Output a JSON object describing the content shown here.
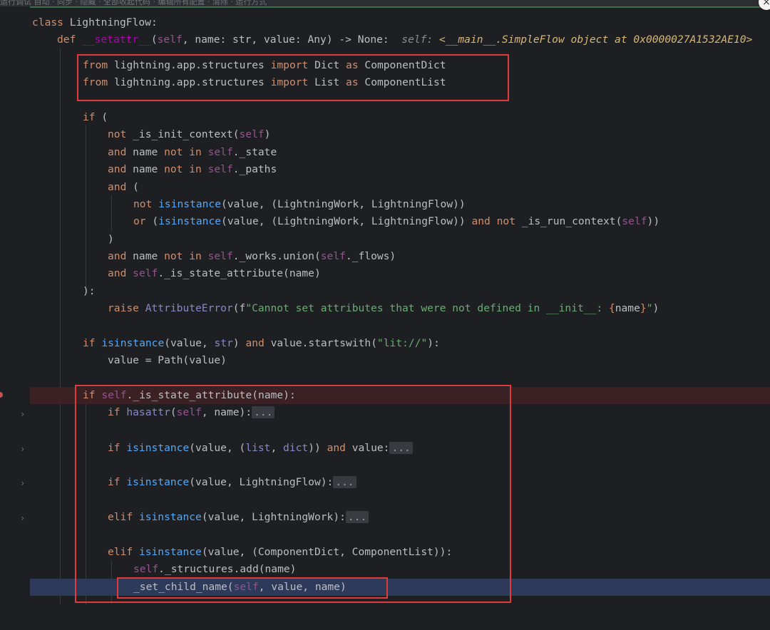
{
  "window": {
    "topbar_text": "运行调试    自动 · 同步 · 隐藏 · 全部收起代码 · 编辑所有配置 · 清除 · 运行方式",
    "close_icon_glyph": "×"
  },
  "colors": {
    "background": "#1e1f22",
    "keyword": "#cf8e6d",
    "self": "#94558d",
    "function": "#56a8f5",
    "string": "#6aab73",
    "breakpoint_line": "#3b2123",
    "current_line": "#2d3a5a",
    "annotation_box": "#e23a3a"
  },
  "code": {
    "class_line": {
      "kw": "class",
      "name": "LightningFlow:"
    },
    "def_line": {
      "kw": "def",
      "fn": "__setattr__",
      "open": "(",
      "self": "self",
      "params": ", name: str, value: Any) -> None:",
      "hint_label": "self:",
      "hint_value": "<__main__.SimpleFlow object at 0x0000027A1532AE10>"
    },
    "import1": {
      "from": "from",
      "mod": " lightning.app.structures ",
      "imp": "import",
      "name": " Dict ",
      "as": "as",
      "alias": " ComponentDict"
    },
    "import2": {
      "from": "from",
      "mod": " lightning.app.structures ",
      "imp": "import",
      "name": " List ",
      "as": "as",
      "alias": " ComponentList"
    },
    "if_open": {
      "kw": "if",
      "rest": " ("
    },
    "cond1": {
      "kw": "not",
      "fn": " _is_init_context(",
      "self": "self",
      "end": ")"
    },
    "cond2": {
      "kw": "and",
      "a": " name ",
      "kw2": "not in",
      "b": " ",
      "self": "self",
      "c": "._state"
    },
    "cond3": {
      "kw": "and",
      "a": " name ",
      "kw2": "not in",
      "b": " ",
      "self": "self",
      "c": "._paths"
    },
    "cond4": {
      "kw": "and",
      "rest": " ("
    },
    "cond5": {
      "kw": "not",
      "fn": " isinstance",
      "rest": "(value, (LightningWork, LightningFlow))"
    },
    "cond6": {
      "kw": "or",
      "a": " (",
      "fn": "isinstance",
      "b": "(value, (LightningWork, LightningFlow)) ",
      "kw2": "and not",
      "c": " _is_run_context(",
      "self": "self",
      "d": "))"
    },
    "cond_close": ")",
    "cond7": {
      "kw": "and",
      "a": " name ",
      "kw2": "not in",
      "b": " ",
      "self": "self",
      "c": "._works.union(",
      "self2": "self",
      "d": "._flows)"
    },
    "cond8": {
      "kw": "and",
      "a": " ",
      "self": "self",
      "c": "._is_state_attribute(name)"
    },
    "if_close": "):",
    "raise": {
      "kw": "raise",
      "a": " ",
      "bi": "AttributeError",
      "b": "(f",
      "str": "\"Cannot set attributes that were not defined in __init__: ",
      "brace": "{",
      "var": "name",
      "brace2": "}",
      "str2": "\"",
      "end": ")"
    },
    "if_str": {
      "kw": "if",
      "fn": " isinstance",
      "a": "(value, ",
      "bi": "str",
      "b": ") ",
      "kw2": "and",
      "c": " value.startswith(",
      "str": "\"lit://\"",
      "d": "):"
    },
    "value_path": "value = Path(value)",
    "if_state": {
      "kw": "if",
      "a": " ",
      "self": "self",
      "b": "._is_state_attribute(name):"
    },
    "hasattr": {
      "kw": "if",
      "bi": " hasattr",
      "a": "(",
      "self": "self",
      "b": ", name):",
      "fold": "..."
    },
    "isinst_list": {
      "kw": "if",
      "fn": " isinstance",
      "a": "(value, (",
      "bi": "list",
      "b": ", ",
      "bi2": "dict",
      "c": ")) ",
      "kw2": "and",
      "d": " value:",
      "fold": "..."
    },
    "isinst_flow": {
      "kw": "if",
      "fn": " isinstance",
      "a": "(value, LightningFlow):",
      "fold": "..."
    },
    "elif_work": {
      "kw": "elif",
      "fn": " isinstance",
      "a": "(value, LightningWork):",
      "fold": "..."
    },
    "elif_struct": {
      "kw": "elif",
      "fn": " isinstance",
      "a": "(value, (ComponentDict, ComponentList)):"
    },
    "struct_add": {
      "self": "self",
      "a": "._structures.add(name)"
    },
    "set_child": {
      "a": "_set_child_name(",
      "self": "self",
      "b": ", value, name)"
    }
  }
}
